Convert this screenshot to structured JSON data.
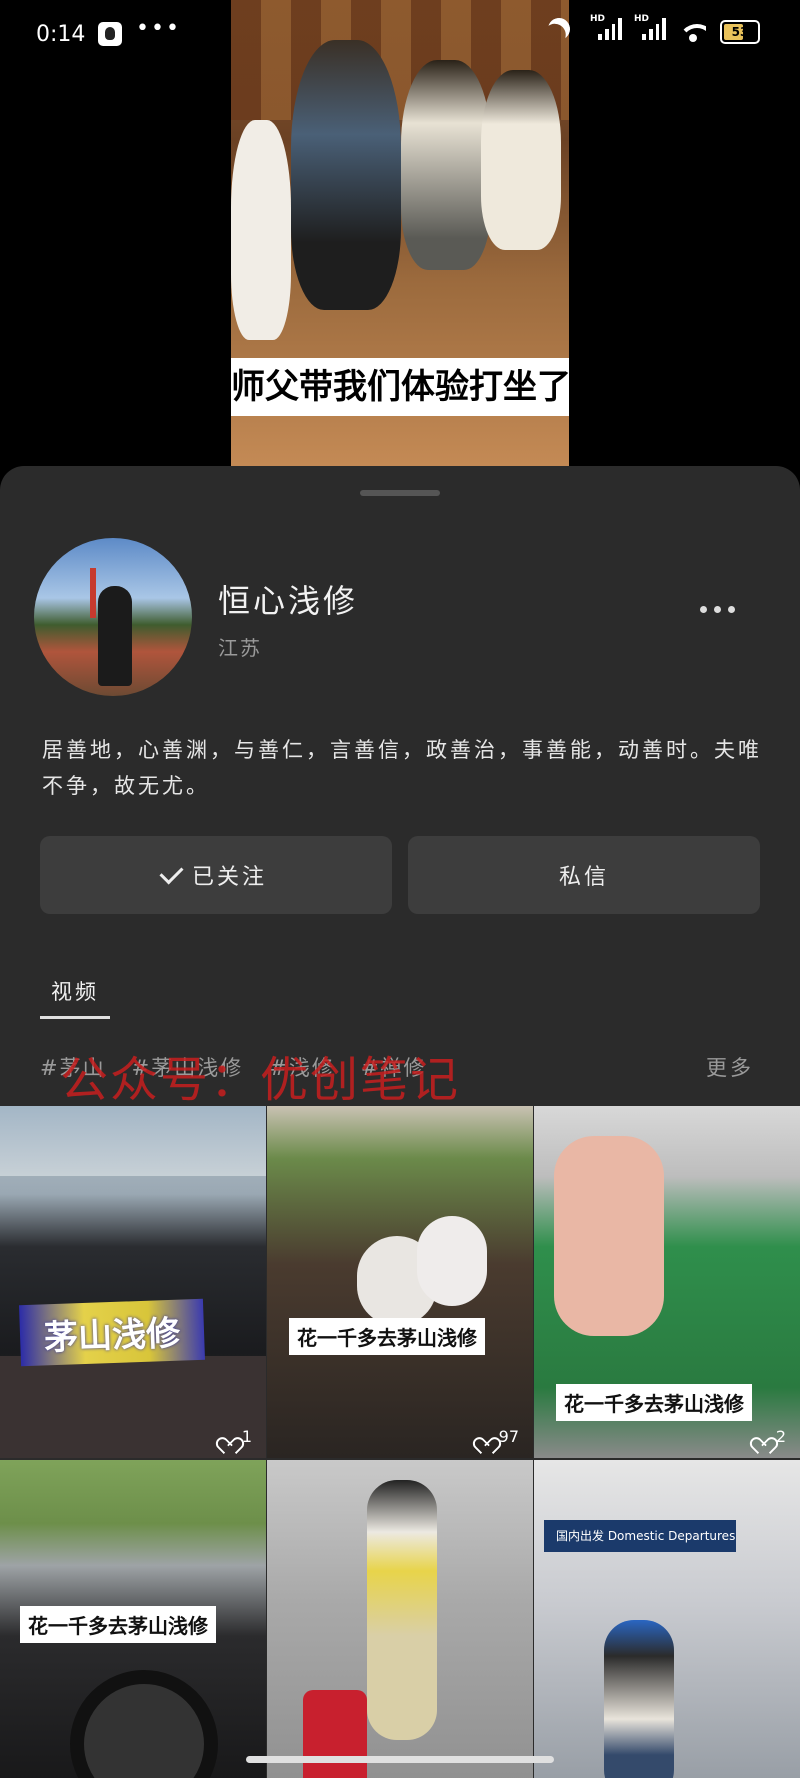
{
  "status_bar": {
    "time": "0:14",
    "more": "•••",
    "battery": "53"
  },
  "video": {
    "caption": "师父带我们体验打坐了"
  },
  "profile": {
    "name": "恒心浅修",
    "location": "江苏",
    "bio": "居善地，心善渊，与善仁，言善信，政善治，事善能，动善时。夫唯不争，故无尤。",
    "follow_label": "已关注",
    "message_label": "私信"
  },
  "tabs": [
    {
      "label": "视频"
    }
  ],
  "tags": [
    "#茅山",
    "#茅山浅修",
    "#浅修",
    "#禅修"
  ],
  "tags_more": "更多",
  "watermark": "公众号：优创笔记",
  "videos": [
    {
      "caption": "茅山浅修",
      "likes": "1"
    },
    {
      "caption": "花一千多去茅山浅修",
      "likes": "97"
    },
    {
      "caption": "花一千多去茅山浅修",
      "likes": "2"
    },
    {
      "caption": "花一千多去茅山浅修",
      "likes": ""
    },
    {
      "caption": "",
      "likes": ""
    },
    {
      "caption": "",
      "likes": "",
      "sign": "国内出发 Domestic Departures"
    }
  ]
}
